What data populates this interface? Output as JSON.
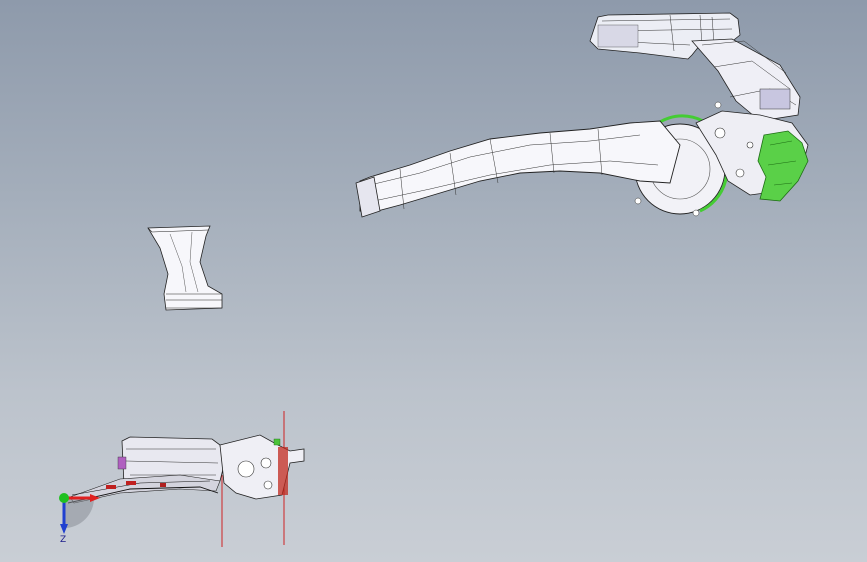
{
  "viewport": {
    "background_top": "#8e9aab",
    "background_bottom": "#c9ced5"
  },
  "parts": [
    {
      "name": "air-duct-assembly",
      "color": "#f4f4f8"
    },
    {
      "name": "vertical-connector-duct",
      "color": "#f4f4f8"
    },
    {
      "name": "side-view-assembly",
      "color": "#e8e8f0"
    }
  ],
  "highlight_color": "#44cc33",
  "triad": {
    "x_color": "#e02020",
    "y_color": "#20c020",
    "z_color": "#2040d0",
    "z_label": "Z"
  },
  "section_line_color": "#d01010"
}
